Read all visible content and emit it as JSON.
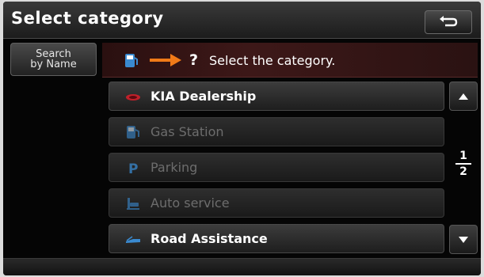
{
  "header": {
    "title": "Select category"
  },
  "search_button": {
    "line1": "Search",
    "line2": "by Name"
  },
  "hint": {
    "question_mark": "?",
    "text": "Select the category."
  },
  "categories": [
    {
      "label": "KIA Dealership",
      "icon": "car-icon",
      "enabled": true,
      "color": "#c0202a"
    },
    {
      "label": "Gas Station",
      "icon": "fuel-pump-icon",
      "enabled": false,
      "color": "#3a8ad0"
    },
    {
      "label": "Parking",
      "icon": "parking-icon",
      "enabled": false,
      "color": "#3a8ad0"
    },
    {
      "label": "Auto service",
      "icon": "car-lift-icon",
      "enabled": false,
      "color": "#3a8ad0"
    },
    {
      "label": "Road Assistance",
      "icon": "tow-truck-icon",
      "enabled": true,
      "color": "#3a8ad0"
    }
  ],
  "pagination": {
    "current": "1",
    "total": "2"
  },
  "colors": {
    "accent_arrow": "#f07a18",
    "icon_blue": "#3a8ad0",
    "dealer_red": "#c0202a"
  }
}
